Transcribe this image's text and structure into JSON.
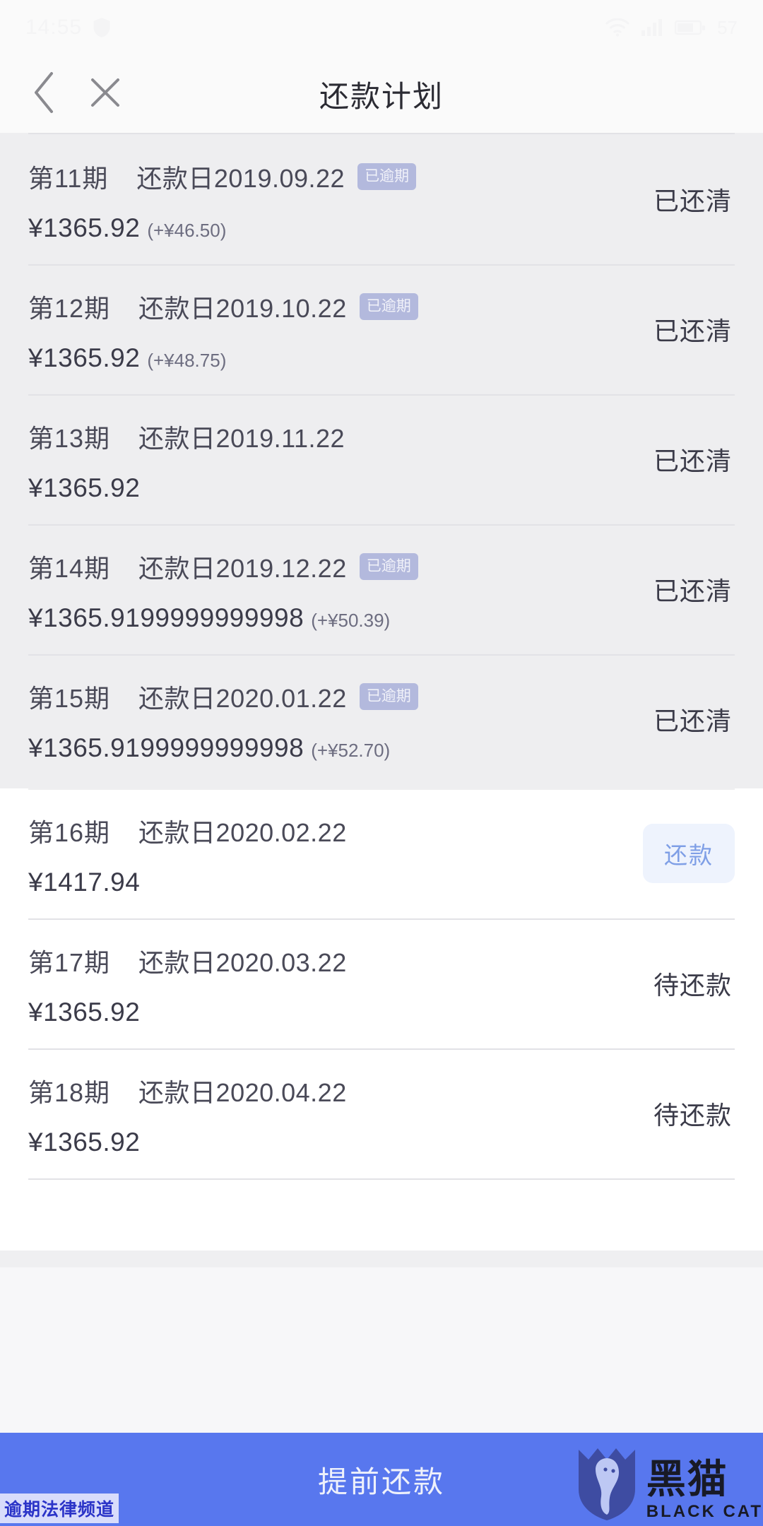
{
  "status_bar": {
    "time": "14:55",
    "shield_icon": "shield-icon",
    "wifi_icon": "wifi-icon",
    "signal_icon": "cellular-signal-icon",
    "battery_icon": "battery-icon",
    "battery_level": "57"
  },
  "nav": {
    "back_icon": "chevron-left-icon",
    "close_icon": "close-icon",
    "title": "还款计划"
  },
  "colors": {
    "accent": "#5877ee",
    "badge_bg": "#b3b9dd",
    "action_bg": "#eef3fd",
    "action_text": "#7f9fe6",
    "paid_section_bg": "#eeeef0",
    "due_section_bg": "#ffffff"
  },
  "paid_rows": [
    {
      "term": "第11期",
      "due_label": "还款日2019.09.22",
      "badge": "已逾期",
      "amount": "¥1365.92",
      "extra": "(+¥46.50)",
      "status": "已还清"
    },
    {
      "term": "第12期",
      "due_label": "还款日2019.10.22",
      "badge": "已逾期",
      "amount": "¥1365.92",
      "extra": "(+¥48.75)",
      "status": "已还清"
    },
    {
      "term": "第13期",
      "due_label": "还款日2019.11.22",
      "badge": "",
      "amount": "¥1365.92",
      "extra": "",
      "status": "已还清"
    },
    {
      "term": "第14期",
      "due_label": "还款日2019.12.22",
      "badge": "已逾期",
      "amount": "¥1365.9199999999998",
      "extra": "(+¥50.39)",
      "status": "已还清"
    },
    {
      "term": "第15期",
      "due_label": "还款日2020.01.22",
      "badge": "已逾期",
      "amount": "¥1365.9199999999998",
      "extra": "(+¥52.70)",
      "status": "已还清"
    }
  ],
  "due_rows": [
    {
      "term": "第16期",
      "due_label": "还款日2020.02.22",
      "badge": "",
      "amount": "¥1417.94",
      "extra": "",
      "action": "还款",
      "status": ""
    },
    {
      "term": "第17期",
      "due_label": "还款日2020.03.22",
      "badge": "",
      "amount": "¥1365.92",
      "extra": "",
      "action": "",
      "status": "待还款"
    },
    {
      "term": "第18期",
      "due_label": "还款日2020.04.22",
      "badge": "",
      "amount": "¥1365.92",
      "extra": "",
      "action": "",
      "status": "待还款"
    }
  ],
  "bottom_bar": {
    "label": "提前还款"
  },
  "watermark": {
    "cn": "黑猫",
    "en": "BLACK CAT",
    "channel": "逾期法律频道",
    "shield_icon": "cat-shield-logo-icon"
  }
}
